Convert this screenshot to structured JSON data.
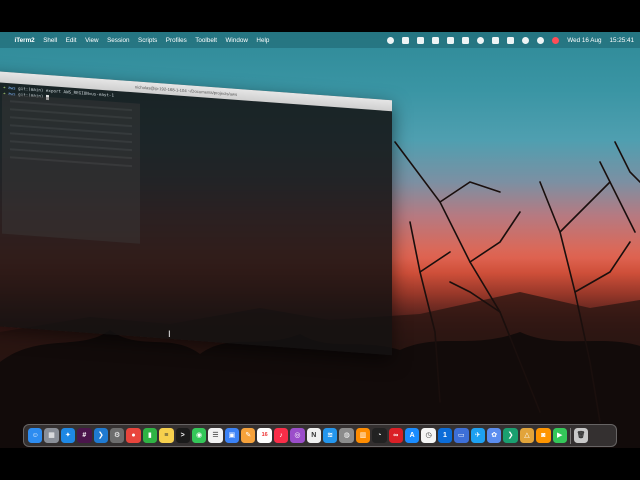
{
  "menubar": {
    "apple_glyph": "",
    "app_name": "iTerm2",
    "menus": [
      "Shell",
      "Edit",
      "View",
      "Session",
      "Scripts",
      "Profiles",
      "Toolbelt",
      "Window",
      "Help"
    ],
    "status_icons": [
      "record-icon",
      "docker-icon",
      "dropbox-icon",
      "clipboard-icon",
      "screen-icon",
      "mail-icon",
      "control-center-icon",
      "bluetooth-icon",
      "battery-icon",
      "wifi-icon",
      "search-icon",
      "user-icon"
    ],
    "date": "Wed 16 Aug",
    "time": "15:25:41"
  },
  "terminal": {
    "title": "nicholas@ip-192-168-1-104 ~/Documents/projects/aws",
    "lines": [
      {
        "prompt": "➜",
        "dir": "aws",
        "cmd": "git:(main) export AWS_REGION=us-east-1"
      },
      {
        "prompt": "➜",
        "dir": "aws",
        "cmd": "git:(main)"
      }
    ]
  },
  "dock": {
    "apps": [
      {
        "name": "Finder",
        "icon": "finder-icon",
        "color": "#2d8cf0",
        "glyph": "☺"
      },
      {
        "name": "Launchpad",
        "icon": "launchpad-icon",
        "color": "#8a8f98",
        "glyph": "▦"
      },
      {
        "name": "Safari",
        "icon": "safari-icon",
        "color": "#1e88e5",
        "glyph": "✦"
      },
      {
        "name": "Slack",
        "icon": "slack-icon",
        "color": "#4a154b",
        "glyph": "#"
      },
      {
        "name": "Visual Studio Code",
        "icon": "vscode-icon",
        "color": "#1f7ad1",
        "glyph": "❯"
      },
      {
        "name": "System Settings",
        "icon": "settings-icon",
        "color": "#6d6d6d",
        "glyph": "⚙"
      },
      {
        "name": "Google Chrome",
        "icon": "chrome-icon",
        "color": "#e8453c",
        "glyph": "●"
      },
      {
        "name": "Numbers",
        "icon": "numbers-icon",
        "color": "#2fb344",
        "glyph": "▮"
      },
      {
        "name": "Notes",
        "icon": "notes-icon",
        "color": "#f6d04d",
        "glyph": "≡"
      },
      {
        "name": "Terminal",
        "icon": "terminal-icon",
        "color": "#1b1b1b",
        "glyph": ">"
      },
      {
        "name": "Messages",
        "icon": "messages-icon",
        "color": "#34c759",
        "glyph": "◉"
      },
      {
        "name": "Reminders",
        "icon": "reminders-icon",
        "color": "#f2f2f2",
        "glyph": "☰"
      },
      {
        "name": "Preview",
        "icon": "preview-icon",
        "color": "#3b82f6",
        "glyph": "▣"
      },
      {
        "name": "Pages",
        "icon": "pages-icon",
        "color": "#f7a23b",
        "glyph": "✎"
      },
      {
        "name": "Calendar",
        "icon": "calendar-icon",
        "color": "#ffffff",
        "glyph": "16"
      },
      {
        "name": "Music",
        "icon": "music-icon",
        "color": "#fa2d48",
        "glyph": "♪"
      },
      {
        "name": "Podcasts",
        "icon": "podcasts-icon",
        "color": "#9b4dca",
        "glyph": "◎"
      },
      {
        "name": "News",
        "icon": "news-icon",
        "color": "#f0f0f0",
        "glyph": "N"
      },
      {
        "name": "Docker",
        "icon": "docker-icon",
        "color": "#2496ed",
        "glyph": "≋"
      },
      {
        "name": "Disk Utility",
        "icon": "disk-utility-icon",
        "color": "#8c8c8c",
        "glyph": "◍"
      },
      {
        "name": "Books",
        "icon": "books-icon",
        "color": "#ff8c00",
        "glyph": "▥"
      },
      {
        "name": "Activity Monitor",
        "icon": "activity-monitor-icon",
        "color": "#222222",
        "glyph": "◔"
      },
      {
        "name": "Creative Cloud",
        "icon": "creative-cloud-icon",
        "color": "#da1f26",
        "glyph": "∞"
      },
      {
        "name": "App Store",
        "icon": "app-store-icon",
        "color": "#1a8cff",
        "glyph": "A"
      },
      {
        "name": "Clock",
        "icon": "clock-icon",
        "color": "#f5f5f5",
        "glyph": "◷"
      },
      {
        "name": "1Password",
        "icon": "onepassword-icon",
        "color": "#0b6cd8",
        "glyph": "1"
      },
      {
        "name": "Screens",
        "icon": "screens-icon",
        "color": "#3d6fd8",
        "glyph": "▭"
      },
      {
        "name": "Twitter",
        "icon": "twitter-icon",
        "color": "#1da1f2",
        "glyph": "✈"
      },
      {
        "name": "Photos",
        "icon": "photos-icon",
        "color": "#5b8def",
        "glyph": "✿"
      },
      {
        "name": "Visual Studio Code Insiders",
        "icon": "vscode-insiders-icon",
        "color": "#1a9f70",
        "glyph": "❯"
      },
      {
        "name": "Grapher",
        "icon": "grapher-icon",
        "color": "#e2a43a",
        "glyph": "△"
      },
      {
        "name": "Photo Booth",
        "icon": "photo-booth-icon",
        "color": "#ff9500",
        "glyph": "◙"
      },
      {
        "name": "FaceTime",
        "icon": "facetime-icon",
        "color": "#34c759",
        "glyph": "▶"
      }
    ],
    "trash": {
      "name": "Trash",
      "icon": "trash-icon",
      "color": "#c9c9c9",
      "glyph": "🗑"
    }
  }
}
